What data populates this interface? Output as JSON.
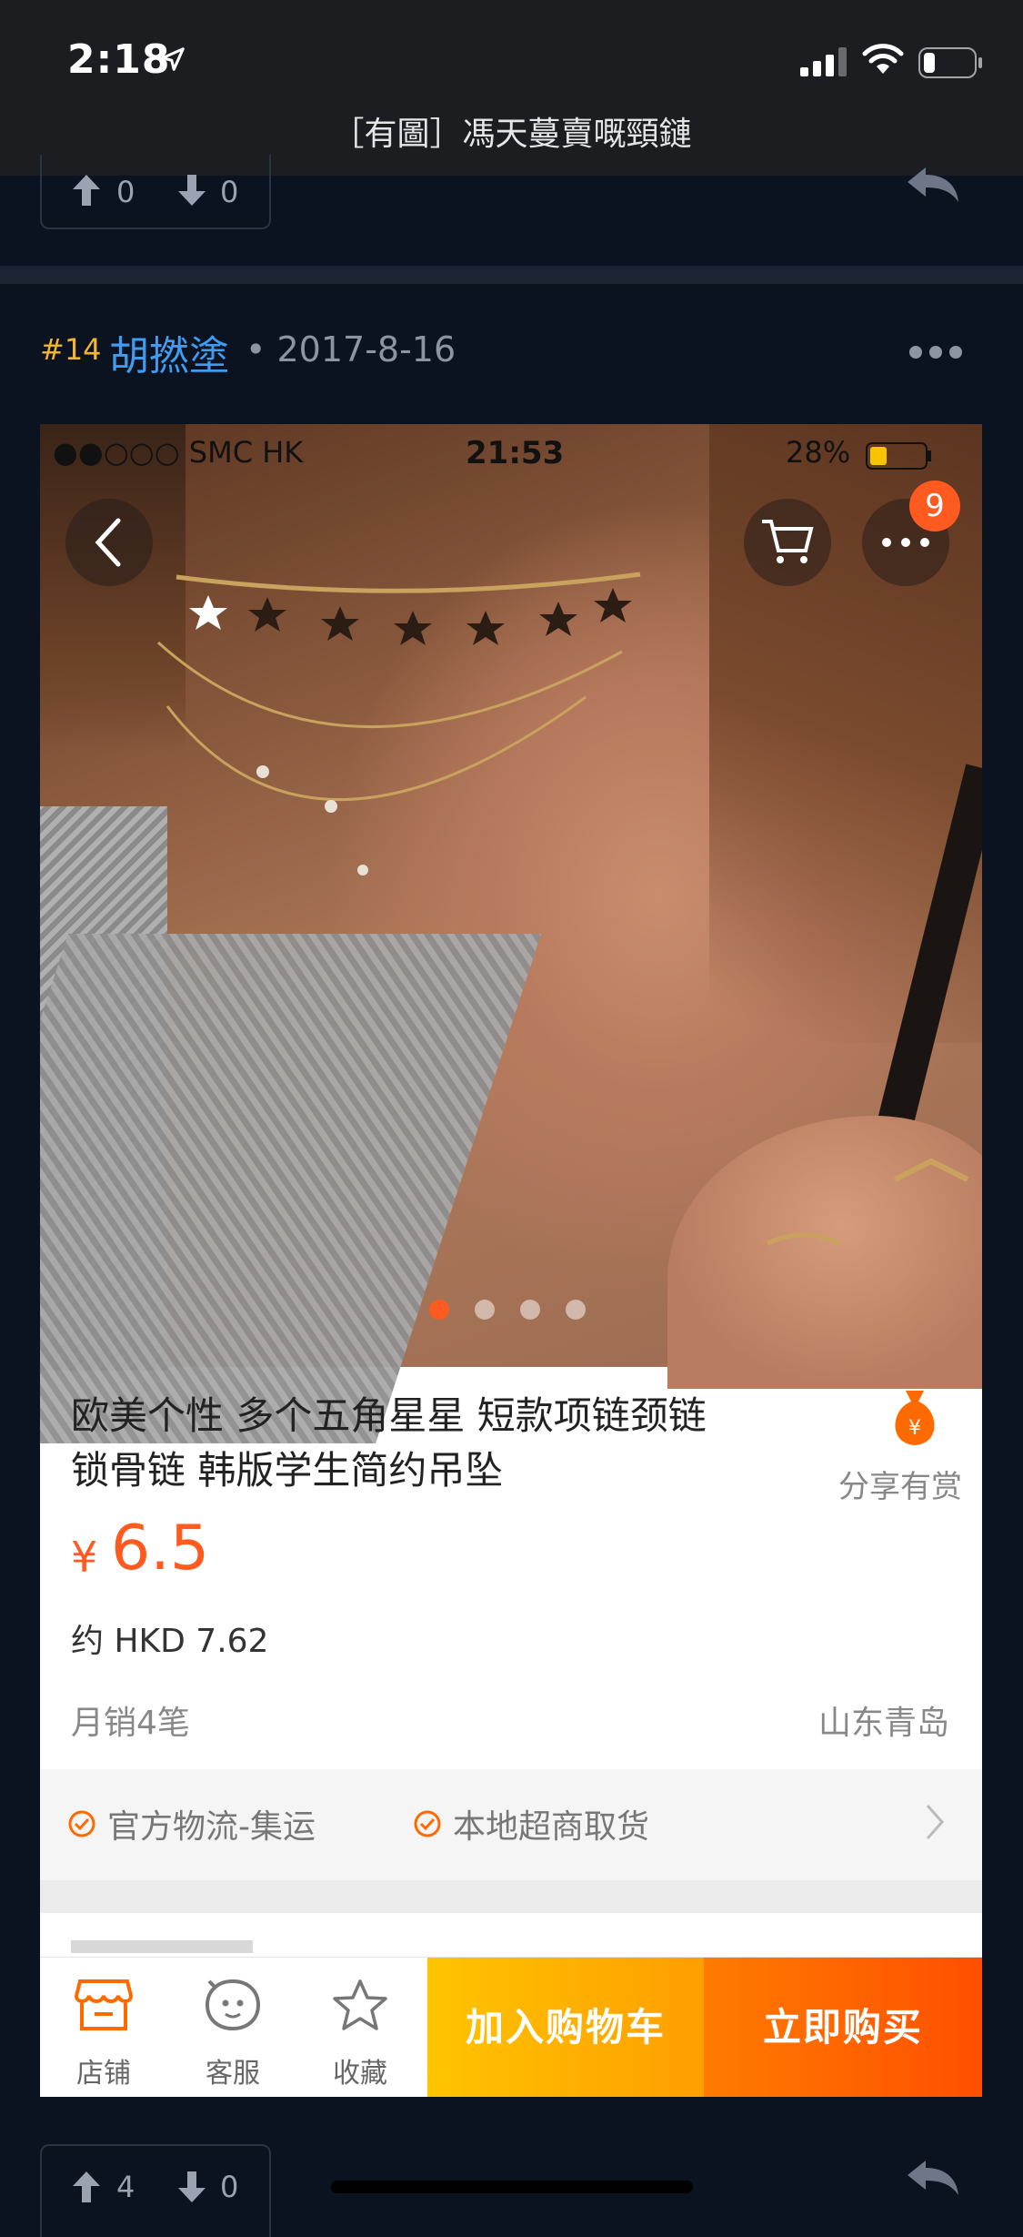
{
  "status_bar": {
    "time": "2:18"
  },
  "nav": {
    "title": "［有圖］馮天蔓賣嘅頸鏈"
  },
  "previous_post": {
    "up_count": "0",
    "down_count": "0"
  },
  "post": {
    "number": "#14",
    "author": "胡撚塗",
    "date": "• 2017-8-16",
    "up_count": "4",
    "down_count": "0"
  },
  "embedded_screenshot": {
    "status": {
      "carrier": "●●○○○ SMC HK",
      "time": "21:53",
      "battery": "28%"
    },
    "more_badge": "9",
    "product_title_line1": "欧美个性 多个五角星星 短款项链颈链",
    "product_title_line2": "锁骨链 韩版学生简约吊坠",
    "share_label": "分享有赏",
    "price_currency": "¥",
    "price_value": "6.5",
    "price_hkd": "约 HKD 7.62",
    "monthly_sales": "月销4笔",
    "origin": "山东青岛",
    "services": [
      "官方物流-集运",
      "本地超商取货"
    ],
    "bottom_bar": {
      "shop_label": "店铺",
      "service_label": "客服",
      "favorite_label": "收藏",
      "add_to_cart": "加入购物车",
      "buy_now": "立即购买"
    },
    "colors": {
      "accent": "#ff5a1f",
      "cart_button": "#ffb300",
      "buy_button": "#ff6a00"
    }
  },
  "colors": {
    "post_number": "#f2b632",
    "author": "#3f9cf0",
    "background": "#0b1220"
  }
}
